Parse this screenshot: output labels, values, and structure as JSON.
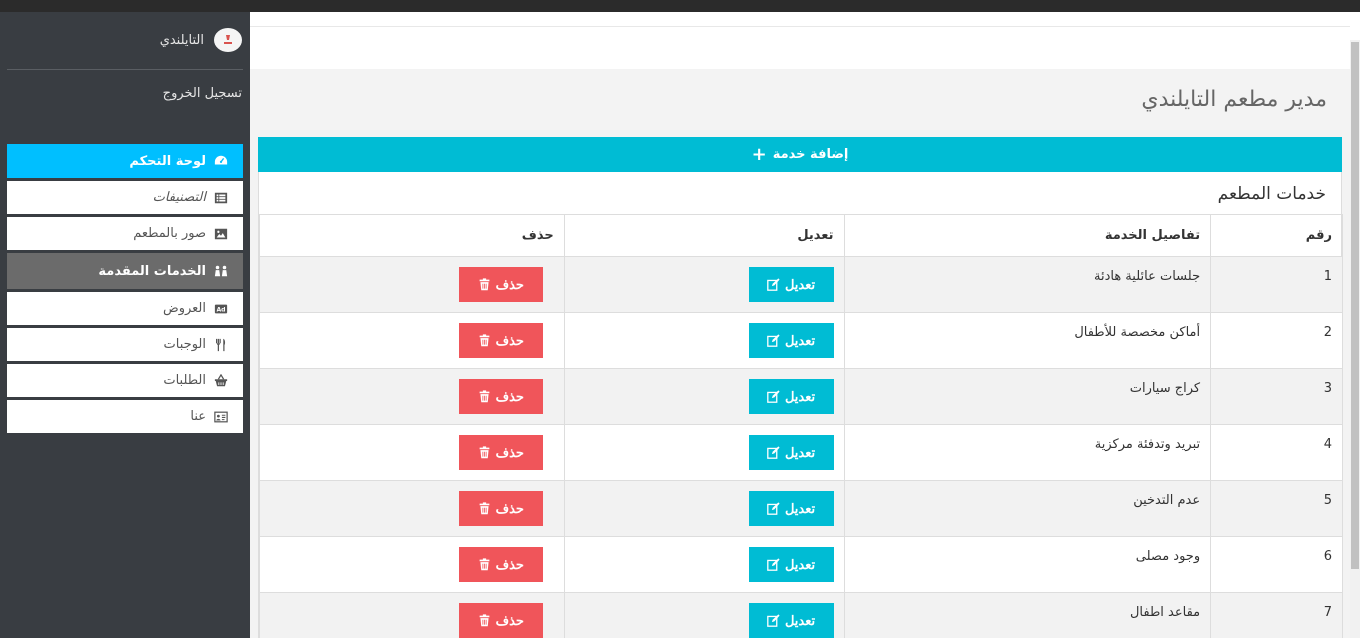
{
  "sidebar": {
    "user_name": "التايلندي",
    "logout": "تسجيل الخروج",
    "items": [
      {
        "label": "لوحة التحكم",
        "icon": "dashboard-icon"
      },
      {
        "label": "التصنيفات",
        "icon": "list-icon"
      },
      {
        "label": "صور بالمطعم",
        "icon": "image-icon"
      },
      {
        "label": "الخدمات المقدمة",
        "icon": "people-icon"
      },
      {
        "label": "العروض",
        "icon": "ad-icon"
      },
      {
        "label": "الوجبات",
        "icon": "utensils-icon"
      },
      {
        "label": "الطلبات",
        "icon": "basket-icon"
      },
      {
        "label": "عنا",
        "icon": "id-card-icon"
      }
    ]
  },
  "page": {
    "title": "مدير مطعم التايلندي",
    "add_button": "إضافة خدمة",
    "panel_title": "خدمات المطعم"
  },
  "table": {
    "headers": [
      "رقم",
      "تفاصيل الخدمة",
      "تعديل",
      "حذف"
    ],
    "edit_label": "تعديل",
    "delete_label": "حذف",
    "rows": [
      {
        "num": "1",
        "detail": "جلسات عائلية هادئة"
      },
      {
        "num": "2",
        "detail": "أماكن مخصصة للأطفال"
      },
      {
        "num": "3",
        "detail": "كراج سيارات"
      },
      {
        "num": "4",
        "detail": "تبريد وتدفئة مركزية"
      },
      {
        "num": "5",
        "detail": "عدم التدخين"
      },
      {
        "num": "6",
        "detail": "وجود مصلى"
      },
      {
        "num": "7",
        "detail": "مقاعد اطفال"
      }
    ]
  },
  "colors": {
    "sidebar_bg": "#393d42",
    "active": "#00bfff",
    "accent": "#00bcd4",
    "danger": "#f0555a"
  }
}
